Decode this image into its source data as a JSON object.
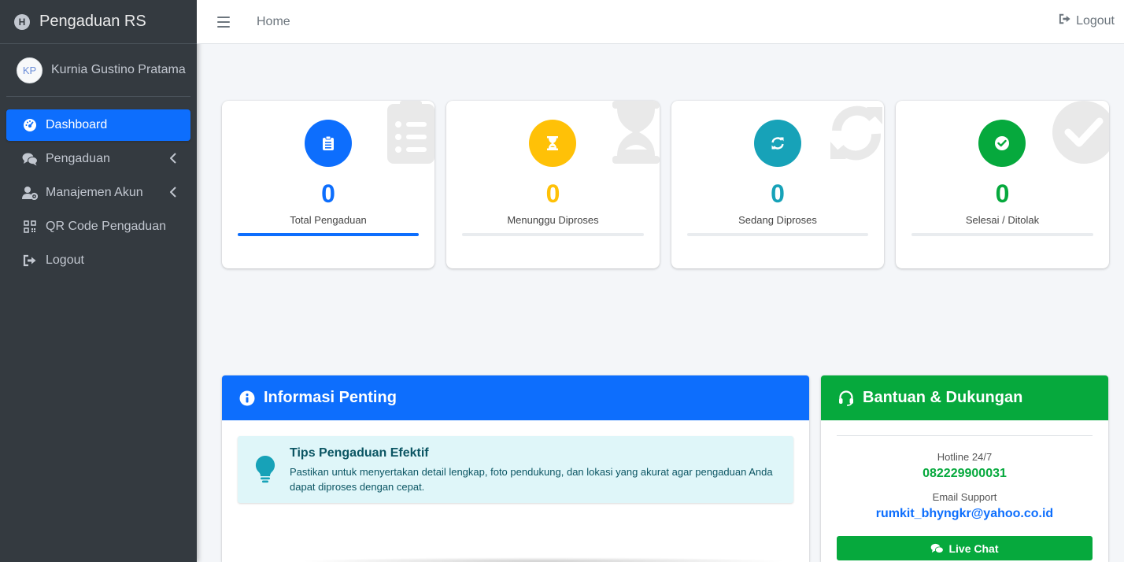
{
  "brand": {
    "title": "Pengaduan RS",
    "logo_letter": "H"
  },
  "user": {
    "initials": "KP",
    "name": "Kurnia Gustino Pratama"
  },
  "sidebar": {
    "items": [
      {
        "label": "Dashboard",
        "icon": "gauge-icon",
        "active": true
      },
      {
        "label": "Pengaduan",
        "icon": "comments-icon",
        "has_arrow": true
      },
      {
        "label": "Manajemen Akun",
        "icon": "users-cog-icon",
        "has_arrow": true
      },
      {
        "label": "QR Code Pengaduan",
        "icon": "qrcode-icon"
      },
      {
        "label": "Logout",
        "icon": "sign-out-icon"
      }
    ]
  },
  "topbar": {
    "home": "Home",
    "logout": "Logout"
  },
  "stats": [
    {
      "value": "0",
      "label": "Total Pengaduan",
      "color": "#0d6efd",
      "icon": "clipboard-list-icon",
      "progress": 1.0
    },
    {
      "value": "0",
      "label": "Menunggu Diproses",
      "color": "#ffc107",
      "icon": "hourglass-icon",
      "progress": 0
    },
    {
      "value": "0",
      "label": "Sedang Diproses",
      "color": "#17a2b8",
      "icon": "sync-icon",
      "progress": 0
    },
    {
      "value": "0",
      "label": "Selesai / Ditolak",
      "color": "#06a93d",
      "icon": "check-circle-icon",
      "progress": 0
    }
  ],
  "info": {
    "title": "Informasi Penting",
    "tip_title": "Tips Pengaduan Efektif",
    "tip_text": "Pastikan untuk menyertakan detail lengkap, foto pendukung, dan lokasi yang akurat agar pengaduan Anda dapat diproses dengan cepat."
  },
  "support": {
    "title": "Bantuan & Dukungan",
    "hotline_label": "Hotline 24/7",
    "hotline_value": "082229900031",
    "email_label": "Email Support",
    "email_value": "rumkit_bhyngkr@yahoo.co.id",
    "live_chat": "Live Chat"
  },
  "colors": {
    "primary": "#0d6efd",
    "success": "#06a93d",
    "sidebar": "#343a40",
    "warning": "#ffc107",
    "info": "#17a2b8"
  }
}
